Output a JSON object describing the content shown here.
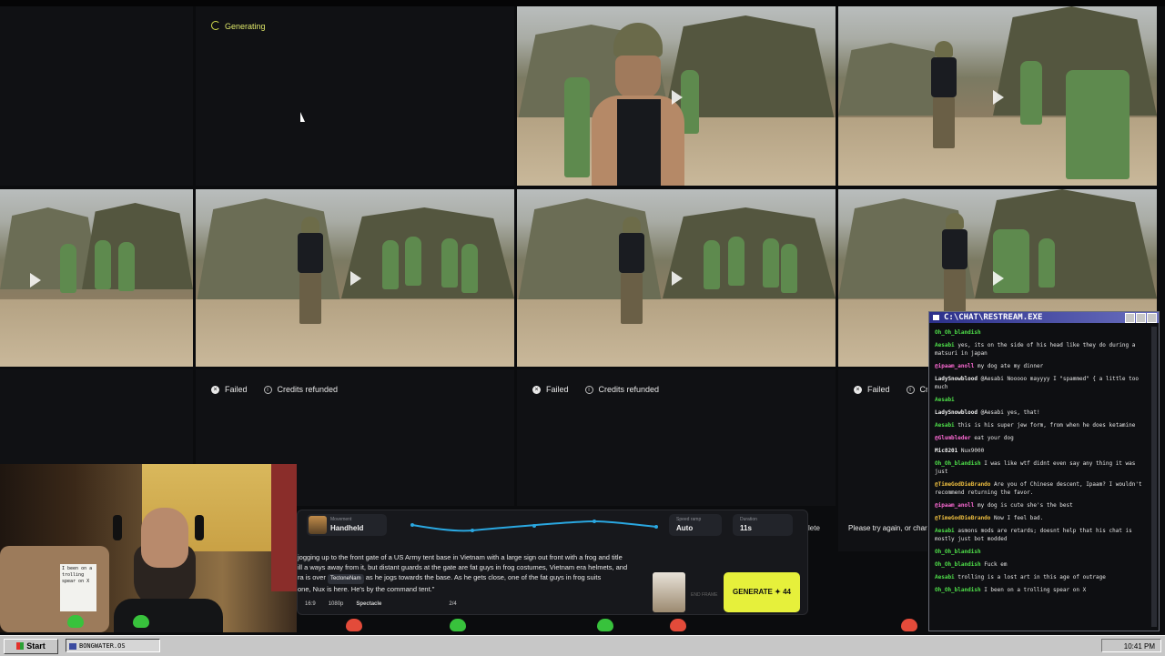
{
  "gallery": {
    "generating_label": "Generating",
    "failed_label": "Failed",
    "refund_label": "Credits refunded",
    "refund_label_cut": "Credi",
    "retry_text": "Please try again, or char"
  },
  "prompt_panel": {
    "movement_label": "Movement",
    "movement_value": "Handheld",
    "speed_label": "Speed ramp",
    "speed_value": "Auto",
    "duration_label": "Duration",
    "duration_value": "11s",
    "delete_label": "lete",
    "prompt_line1": " jogging up to the front gate of a US Army tent base in Vietnam with a large sign out front with a frog and title",
    "prompt_line2": "ill a ways away from it, but distant guards at the gate are fat guys in frog costumes, Vietnam era helmets, and",
    "prompt_line3a": "ra is over ",
    "prompt_mention": "TectoneNam",
    "prompt_line3b": " as he jogs towards the base. As he gets close, one of the fat guys in frog suits",
    "prompt_line4": "one, Nux is here. He's by the command tent.\"",
    "aspect": "16:9",
    "resolution": "1080p",
    "style": "Spectacle",
    "count": "2/4",
    "end_frame": "END FRAME",
    "generate_label": "GENERATE",
    "generate_cost": "44"
  },
  "chat": {
    "title": "C:\\CHAT\\RESTREAM.EXE",
    "messages": [
      {
        "user": "Oh_Oh_blandish",
        "text": ""
      },
      {
        "user": "Aesabi",
        "text": "yes, its on the side of his head like they do during a matsuri in japan"
      },
      {
        "user": "@ipaam_anoll",
        "text": "my dog ate my dinner"
      },
      {
        "user": "LadySnowblood",
        "text": "@Aesabi Nooooo mayyyy I \"spammed\" { a little too much"
      },
      {
        "user": "Aesabi",
        "text": ""
      },
      {
        "user": "LadySnowblood",
        "text": "@Aesabi yes, that!"
      },
      {
        "user": "Aesabi",
        "text": "this is his super jew form, from when he does ketamine"
      },
      {
        "user": "@Glumbleder",
        "text": "eat your dog"
      },
      {
        "user": "Mic8201",
        "text": "Nux9000"
      },
      {
        "user": "Oh_Oh_blandish",
        "text": "I was like wtf didnt even say any thing it was just"
      },
      {
        "user": "@TimeGodDieBrando",
        "text": "Are you of Chinese descent, Ipaam? I wouldn't recommend returning the favor."
      },
      {
        "user": "@ipaam_anoll",
        "text": "my dog is cute she's the best"
      },
      {
        "user": "@TimeGodDieBrando",
        "text": "Now I feel bad."
      },
      {
        "user": "Aesabi",
        "text": "asmons mods are retards; doesnt help that his chat is mostly just bot modded"
      },
      {
        "user": "Oh_Oh_blandish",
        "text": ""
      },
      {
        "user": "Oh_Oh_blandish",
        "text": "Fuck em"
      },
      {
        "user": "Aesabi",
        "text": "trolling is a lost art in this age of outrage"
      },
      {
        "user": "Oh_Oh_blandish",
        "text": "I been on a trolling spear on X"
      }
    ]
  },
  "webcam": {
    "note": "I been on a trolling spear on X"
  },
  "taskbar": {
    "start_label": "Start",
    "window_label": "BONGWATER.OS",
    "clock": "10:41 PM"
  }
}
